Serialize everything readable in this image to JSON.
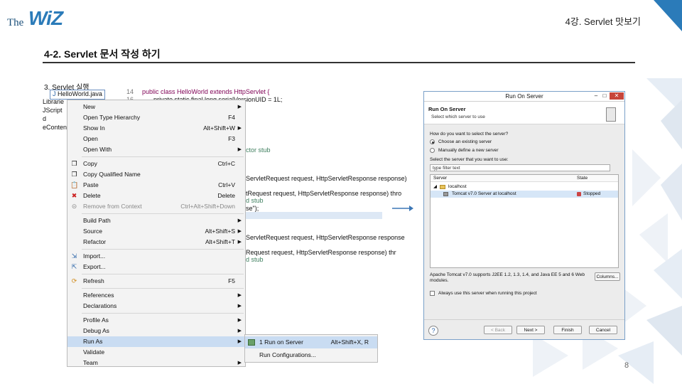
{
  "header": {
    "logo_the": "The",
    "logo_wiz": "WiZ",
    "chapter": "4강. Servlet 맛보기"
  },
  "section_title": "4-2. Servlet 문서 작성 하기",
  "step_label": "3. Servlet 실행",
  "explorer": {
    "selected_file": "HelloWorld.java",
    "items": [
      "Librarie",
      "JScript",
      "d",
      "eContent"
    ]
  },
  "editor": {
    "lines": [
      "public class HelloWorld extends HttpServlet {",
      "private static final long serialVersionUID = 1L;",
      "ctor stub",
      "ServletRequest request, HttpServletResponse response)",
      "tRequest request, HttpServletResponse response) thro",
      "d stub",
      "se\");",
      "ServletRequest request, HttpServletResponse response",
      "Request request, HttpServletResponse response) thr",
      "d stub"
    ],
    "line_numbers": [
      "14",
      "16"
    ]
  },
  "context_menu": {
    "items": [
      {
        "label": "New",
        "shortcut": "",
        "submenu": true,
        "icon": "",
        "disabled": false
      },
      {
        "label": "Open Type Hierarchy",
        "shortcut": "F4",
        "submenu": false,
        "icon": "",
        "disabled": false
      },
      {
        "label": "Show In",
        "shortcut": "Alt+Shift+W",
        "submenu": true,
        "icon": "",
        "disabled": false
      },
      {
        "label": "Open",
        "shortcut": "F3",
        "submenu": false,
        "icon": "",
        "disabled": false
      },
      {
        "label": "Open With",
        "shortcut": "",
        "submenu": true,
        "icon": "",
        "disabled": false
      },
      {
        "label": "Copy",
        "shortcut": "Ctrl+C",
        "submenu": false,
        "icon": "copy-icon",
        "disabled": false
      },
      {
        "label": "Copy Qualified Name",
        "shortcut": "",
        "submenu": false,
        "icon": "copy-icon",
        "disabled": false
      },
      {
        "label": "Paste",
        "shortcut": "Ctrl+V",
        "submenu": false,
        "icon": "paste-icon",
        "disabled": false
      },
      {
        "label": "Delete",
        "shortcut": "Delete",
        "submenu": false,
        "icon": "delete-icon",
        "disabled": false
      },
      {
        "label": "Remove from Context",
        "shortcut": "Ctrl+Alt+Shift+Down",
        "submenu": false,
        "icon": "remove-icon",
        "disabled": true
      },
      {
        "label": "Build Path",
        "shortcut": "",
        "submenu": true,
        "icon": "",
        "disabled": false
      },
      {
        "label": "Source",
        "shortcut": "Alt+Shift+S",
        "submenu": true,
        "icon": "",
        "disabled": false
      },
      {
        "label": "Refactor",
        "shortcut": "Alt+Shift+T",
        "submenu": true,
        "icon": "",
        "disabled": false
      },
      {
        "label": "Import...",
        "shortcut": "",
        "submenu": false,
        "icon": "import-icon",
        "disabled": false
      },
      {
        "label": "Export...",
        "shortcut": "",
        "submenu": false,
        "icon": "export-icon",
        "disabled": false
      },
      {
        "label": "Refresh",
        "shortcut": "F5",
        "submenu": false,
        "icon": "refresh-icon",
        "disabled": false
      },
      {
        "label": "References",
        "shortcut": "",
        "submenu": true,
        "icon": "",
        "disabled": false
      },
      {
        "label": "Declarations",
        "shortcut": "",
        "submenu": true,
        "icon": "",
        "disabled": false
      },
      {
        "label": "Profile As",
        "shortcut": "",
        "submenu": true,
        "icon": "",
        "disabled": false
      },
      {
        "label": "Debug As",
        "shortcut": "",
        "submenu": true,
        "icon": "",
        "disabled": false
      },
      {
        "label": "Run As",
        "shortcut": "",
        "submenu": true,
        "icon": "",
        "disabled": false
      },
      {
        "label": "Validate",
        "shortcut": "",
        "submenu": false,
        "icon": "",
        "disabled": false
      },
      {
        "label": "Team",
        "shortcut": "",
        "submenu": true,
        "icon": "",
        "disabled": false
      }
    ]
  },
  "submenu": {
    "items": [
      {
        "label": "1 Run on Server",
        "shortcut": "Alt+Shift+X, R"
      },
      {
        "label": "Run Configurations...",
        "shortcut": ""
      }
    ]
  },
  "dialog": {
    "title": "Run On Server",
    "heading": "Run On Server",
    "subheading": "Select which server to use",
    "question": "How do you want to select the server?",
    "radio_existing": "Choose an existing server",
    "radio_manual": "Manually define a new server",
    "filter_label": "Select the server that you want to use:",
    "filter_value": "type filter text",
    "col_server": "Server",
    "col_state": "State",
    "tree_host": "localhost",
    "tree_server": "Tomcat v7.0 Server at localhost",
    "tree_state": "Stopped",
    "description": "Apache Tomcat v7.0 supports J2EE 1.2, 1.3, 1.4, and Java EE 5 and 6 Web modules.",
    "columns_button": "Columns...",
    "always_use": "Always use this server when running this project",
    "back": "< Back",
    "next": "Next >",
    "finish": "Finish",
    "cancel": "Cancel",
    "help": "?"
  },
  "page_number": "8",
  "colors": {
    "accent": "#2b7bb9",
    "menu_highlight": "#c9dcf2",
    "close_button": "#c7453a"
  }
}
